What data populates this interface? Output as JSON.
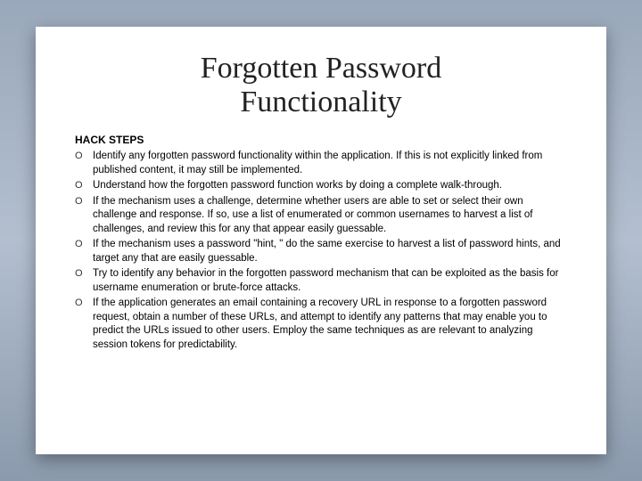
{
  "title_line1": "Forgotten Password",
  "title_line2": "Functionality",
  "section_label": "HACK STEPS",
  "bullet_glyph": "O",
  "steps": [
    "Identify any forgotten password functionality within the application. If this is not explicitly linked from published content, it may still be implemented.",
    "Understand how the forgotten password function works by doing a complete walk-through.",
    "If the mechanism uses a challenge, determine whether users are able to set or select their own challenge and response. If so, use a list of enumerated or common usernames to harvest a list of challenges, and review this for any that appear easily guessable.",
    "If the mechanism uses a password \"hint, \" do the same exercise to harvest a list of password hints, and target any that are easily guessable.",
    "Try to identify any behavior in the forgotten password mechanism that can be exploited as the basis for username enumeration or brute-force attacks.",
    "If the application generates an email containing a recovery URL in response to a forgotten password request, obtain a number of these URLs, and attempt to identify any patterns that may enable you to predict the URLs issued to other users. Employ the same techniques as are relevant to analyzing session tokens for predictability."
  ]
}
